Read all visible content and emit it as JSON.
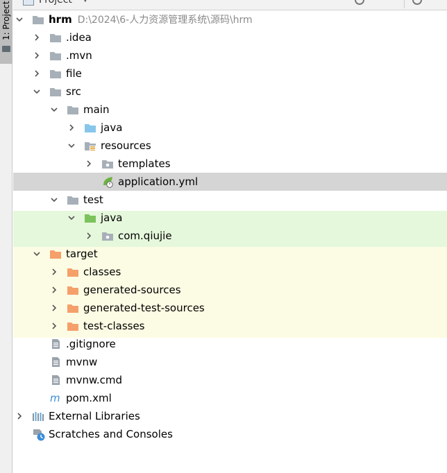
{
  "colors": {
    "selection": "#d5d5d5",
    "test_band": "#e5f8dc",
    "target_band": "#fcfce4",
    "folder_grey": "#a7b0b8",
    "folder_blue": "#87c6ea",
    "folder_green": "#7cc35d",
    "folder_orange": "#f5a06a"
  },
  "sidebar": {
    "tab_label": "1: Project"
  },
  "header": {
    "title": "Project"
  },
  "tree": {
    "root": {
      "name": "hrm",
      "path": "D:\\2024\\6-人力资源管理系统\\源码\\hrm"
    },
    "items": [
      {
        "label": ".idea",
        "icon": "folder-grey",
        "expanded": false
      },
      {
        "label": ".mvn",
        "icon": "folder-grey",
        "expanded": false
      },
      {
        "label": "file",
        "icon": "folder-grey",
        "expanded": false
      },
      {
        "label": "src",
        "icon": "folder-grey",
        "expanded": true
      },
      {
        "label": "main",
        "icon": "folder-grey",
        "expanded": true
      },
      {
        "label": "java",
        "icon": "folder-blue",
        "expanded": false
      },
      {
        "label": "resources",
        "icon": "resources-folder",
        "expanded": true
      },
      {
        "label": "templates",
        "icon": "package-folder",
        "expanded": false
      },
      {
        "label": "application.yml",
        "icon": "spring-file",
        "selected": true
      },
      {
        "label": "test",
        "icon": "folder-grey",
        "expanded": true
      },
      {
        "label": "java",
        "icon": "folder-green",
        "expanded": true
      },
      {
        "label": "com.qiujie",
        "icon": "package-folder",
        "expanded": false
      },
      {
        "label": "target",
        "icon": "folder-orange",
        "expanded": true
      },
      {
        "label": "classes",
        "icon": "folder-orange",
        "expanded": false
      },
      {
        "label": "generated-sources",
        "icon": "folder-orange",
        "expanded": false
      },
      {
        "label": "generated-test-sources",
        "icon": "folder-orange",
        "expanded": false
      },
      {
        "label": "test-classes",
        "icon": "folder-orange",
        "expanded": false
      },
      {
        "label": ".gitignore",
        "icon": "text-file"
      },
      {
        "label": "mvnw",
        "icon": "text-file"
      },
      {
        "label": "mvnw.cmd",
        "icon": "text-file"
      },
      {
        "label": "pom.xml",
        "icon": "maven-file"
      },
      {
        "label": "External Libraries",
        "icon": "libraries",
        "expanded": false
      },
      {
        "label": "Scratches and Consoles",
        "icon": "scratches"
      }
    ]
  }
}
